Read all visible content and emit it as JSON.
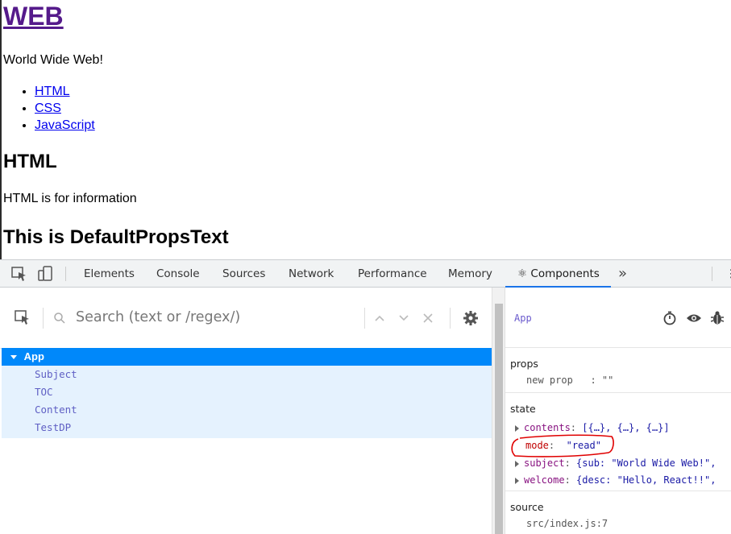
{
  "page": {
    "title": "WEB",
    "intro": "World Wide Web!",
    "toc": [
      "HTML",
      "CSS",
      "JavaScript"
    ],
    "section_heading": "HTML",
    "section_text": "HTML is for information",
    "default_props_heading": "This is DefaultPropsText"
  },
  "devtools": {
    "tabs": [
      "Elements",
      "Console",
      "Sources",
      "Network",
      "Performance",
      "Memory",
      "⚛ Components"
    ],
    "active_tab": "⚛ Components",
    "more_tabs_glyph": "»",
    "search_placeholder": "Search (text or /regex/)",
    "tree": {
      "root": "App",
      "children": [
        "Subject",
        "TOC",
        "Content",
        "TestDP"
      ]
    },
    "inspector": {
      "component_name": "App",
      "props_title": "props",
      "props": [
        {
          "key": "new prop",
          "value": "\"\""
        }
      ],
      "state_title": "state",
      "state": [
        {
          "key": "contents",
          "value": "[{…}, {…}, {…}]",
          "expandable": true
        },
        {
          "key": "mode",
          "value": "\"read\"",
          "expandable": false,
          "highlighted": true
        },
        {
          "key": "subject",
          "value": "{sub: \"World Wide Web!\",",
          "expandable": true
        },
        {
          "key": "welcome",
          "value": "{desc: \"Hello, React!!\",",
          "expandable": true
        }
      ],
      "source_title": "source",
      "source_value": "src/index.js:7"
    },
    "colors": {
      "accent": "#1a73e8",
      "selected_row": "#0088fa",
      "child_row": "#e5f2fe",
      "annotation": "#e00000"
    }
  }
}
